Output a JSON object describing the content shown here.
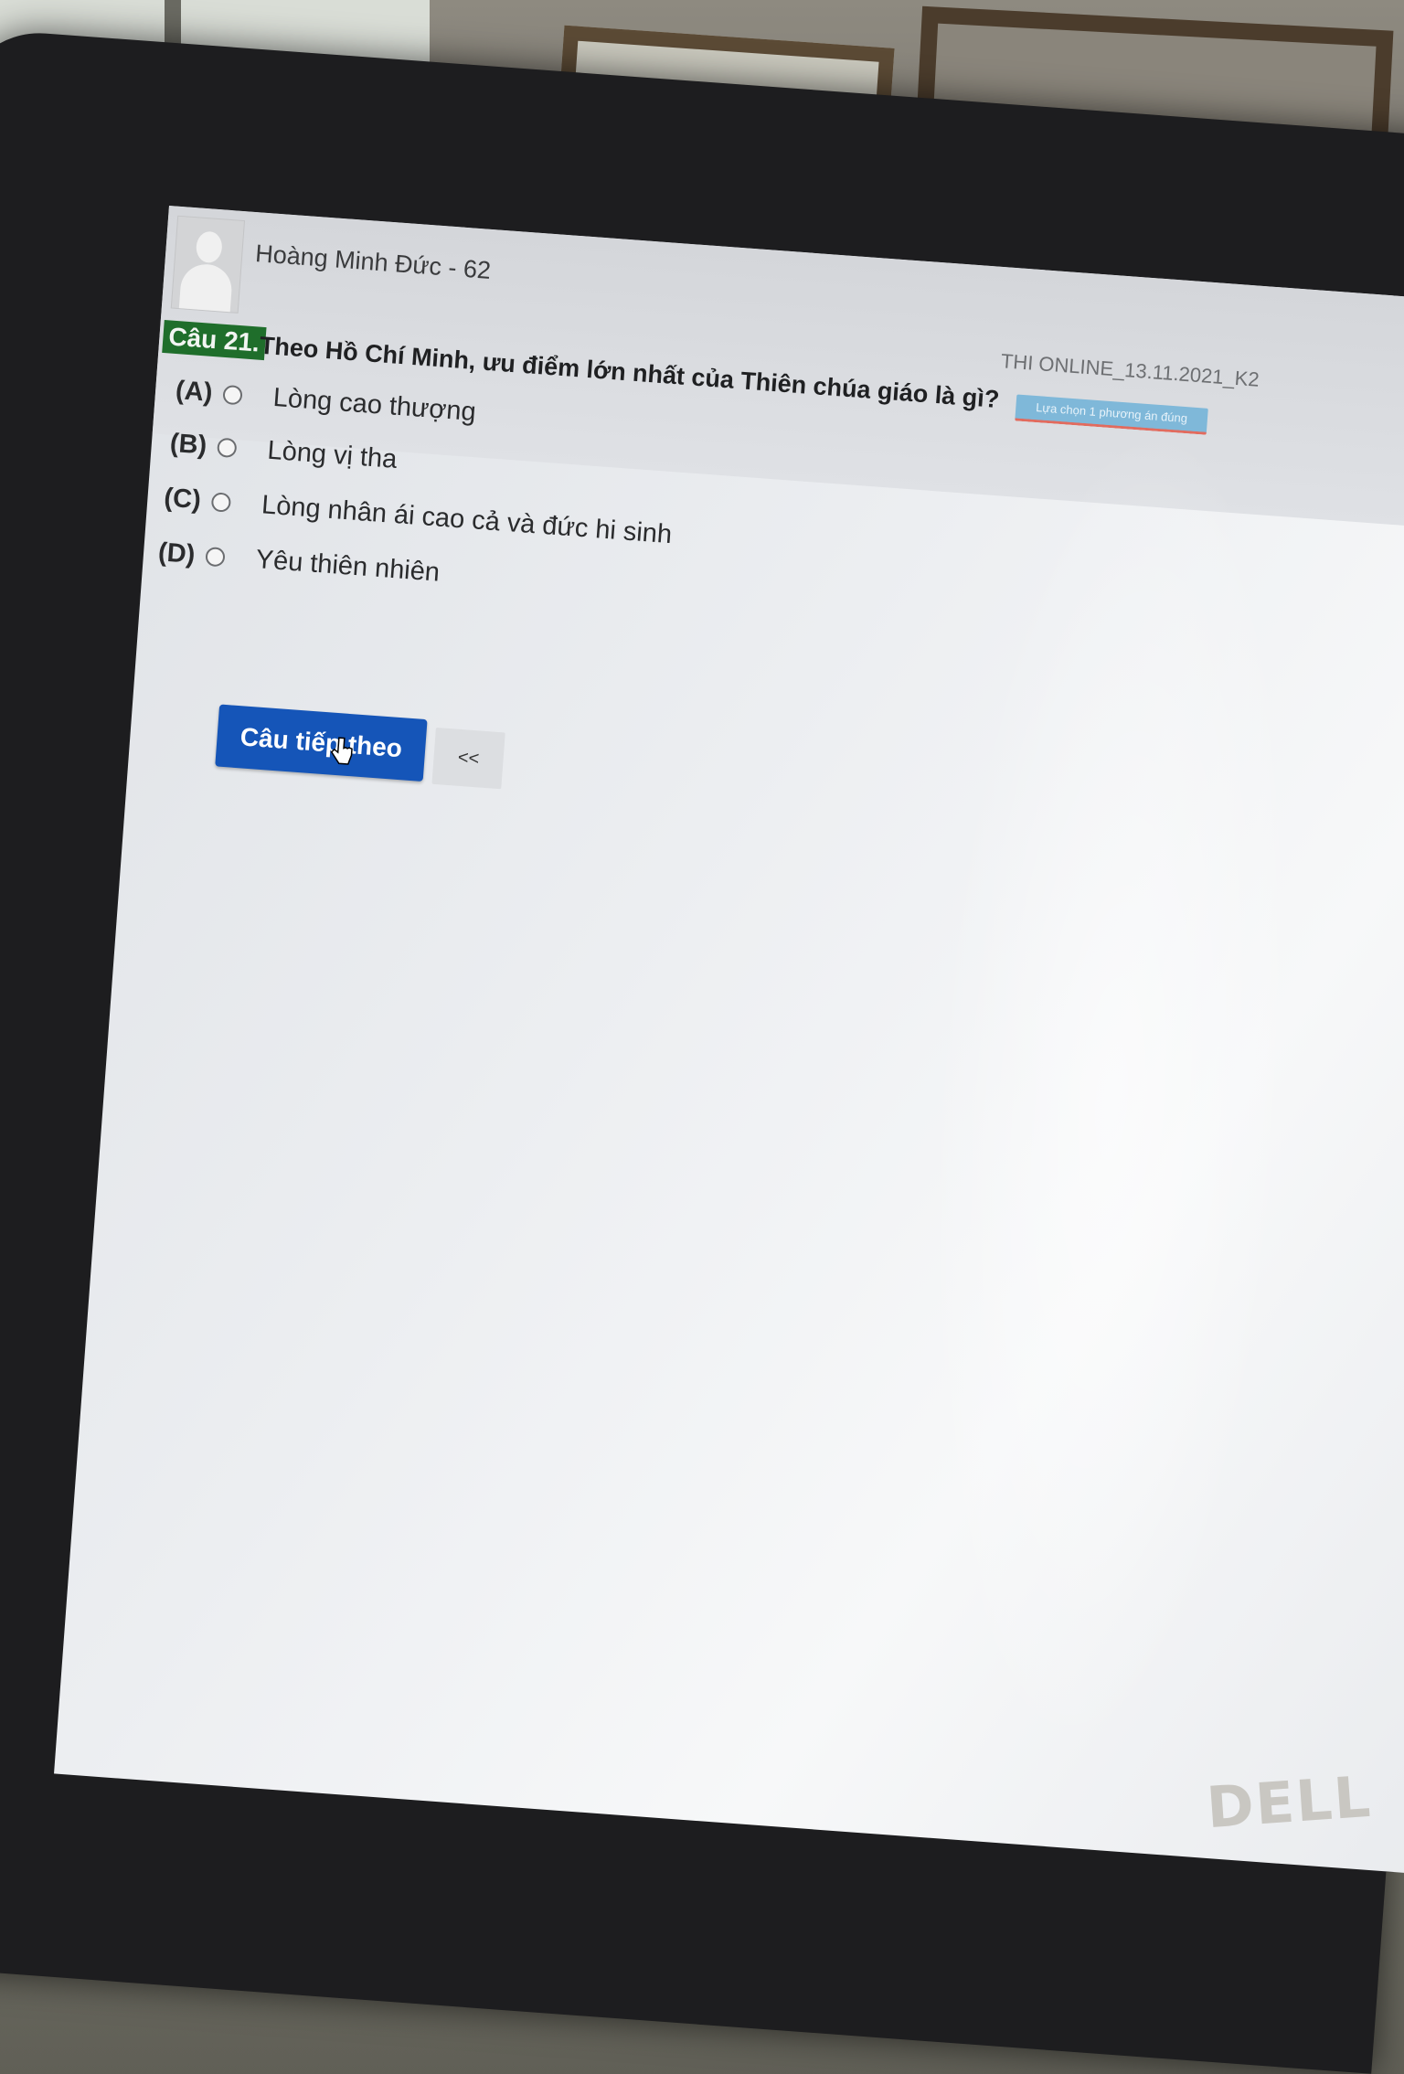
{
  "user": {
    "name": "Hoàng Minh Đức - 62"
  },
  "exam": {
    "code": "THI ONLINE_13.11.2021_K2",
    "hint": "Lựa chọn 1 phương án đúng"
  },
  "question": {
    "label": "Câu 21.",
    "text": "Theo Hồ Chí Minh, ưu điểm lớn nhất của Thiên chúa giáo là gì?",
    "options": [
      {
        "key": "(A)",
        "text": "Lòng cao thượng"
      },
      {
        "key": "(B)",
        "text": "Lòng vị tha"
      },
      {
        "key": "(C)",
        "text": "Lòng nhân ái cao cả và đức hi sinh"
      },
      {
        "key": "(D)",
        "text": "Yêu thiên nhiên"
      }
    ]
  },
  "buttons": {
    "next": "Câu tiếp theo",
    "back": "<<"
  },
  "device": {
    "brand": "DELL"
  },
  "colors": {
    "question_badge": "#1f6e2b",
    "next_button": "#1555b8",
    "hint_badge": "#7fb8d9"
  }
}
